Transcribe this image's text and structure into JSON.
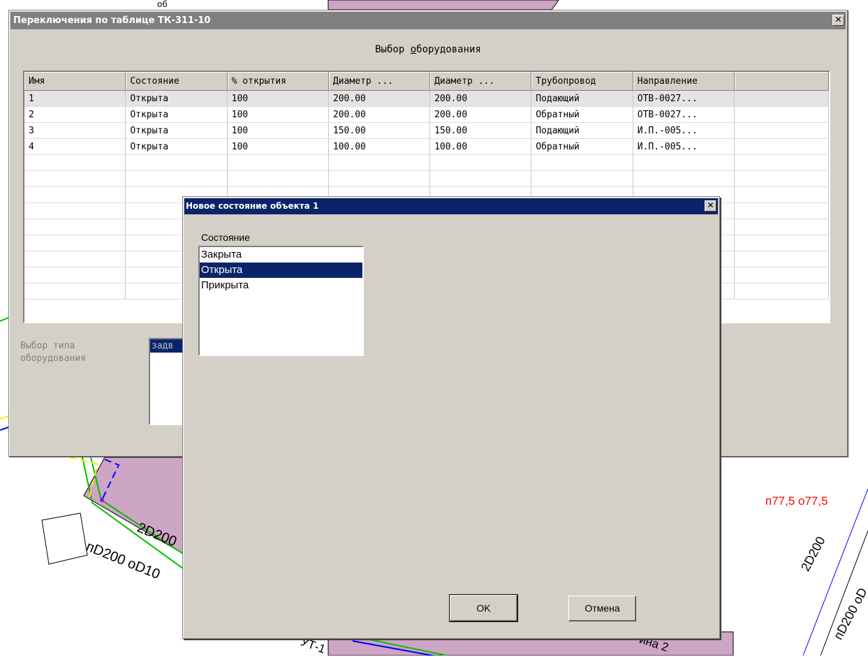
{
  "map": {
    "labels": [
      "2D200",
      "пD200 оD10",
      "п77,5 о77,5",
      "2D200",
      "пD200 оD",
      "УТ-1",
      "ина 2",
      "об"
    ]
  },
  "main_window": {
    "title": "Переключения по таблице ТК-311-10",
    "close_glyph": "✕",
    "heading_before": "Выбор ",
    "heading_mnemonic": "о",
    "heading_after": "борудования",
    "columns": [
      "Имя",
      "Состояние",
      "% открытия",
      "Диаметр ...",
      "Диаметр ...",
      "Трубопровод",
      "Направление"
    ],
    "rows": [
      [
        "1",
        "Открыта",
        "100",
        "200.00",
        "200.00",
        "Подающий",
        "ОТВ-0027..."
      ],
      [
        "2",
        "Открыта",
        "100",
        "200.00",
        "200.00",
        "Обратный",
        "ОТВ-0027..."
      ],
      [
        "3",
        "Открыта",
        "100",
        "150.00",
        "150.00",
        "Подающий",
        "И.П.-005..."
      ],
      [
        "4",
        "Открыта",
        "100",
        "100.00",
        "100.00",
        "Обратный",
        "И.П.-005..."
      ]
    ],
    "type_label": "Выбор типа оборудования",
    "type_list_item": "задв"
  },
  "dialog": {
    "title": "Новое состояние объекта 1",
    "close_glyph": "✕",
    "state_caption": "Состояние",
    "options": [
      "Закрыта",
      "Открыта",
      "Прикрыта"
    ],
    "selected_index": 1,
    "ok_label": "OK",
    "cancel_label": "Отмена"
  },
  "colors": {
    "window_face": "#d4d0c8",
    "active_title": "#0a246a",
    "inactive_title": "#808080",
    "map_building": "#cda5c5",
    "map_pipe_green": "#00c000",
    "map_pipe_blue": "#0000ff",
    "map_pipe_yellow": "#f0f000",
    "map_label_red": "#ff0000"
  }
}
